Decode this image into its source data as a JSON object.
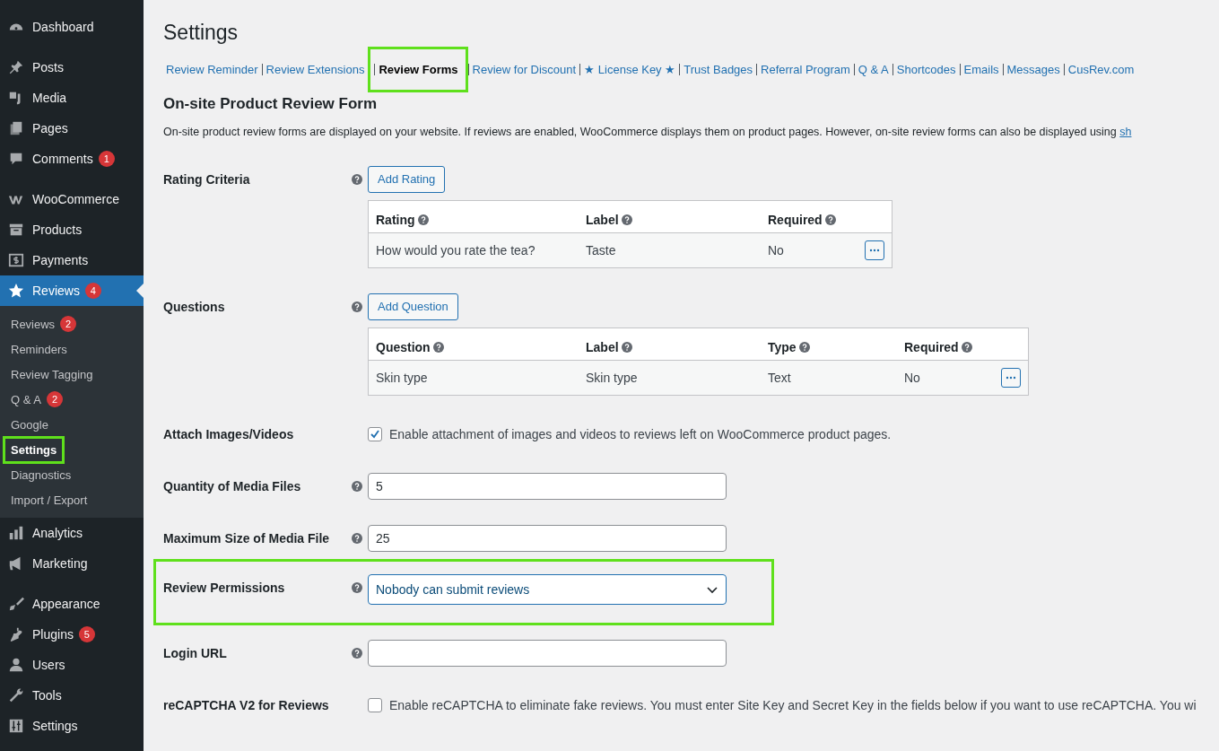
{
  "sidebar": {
    "groups": [
      [
        {
          "label": "Dashboard",
          "selected": false
        }
      ],
      [
        {
          "label": "Posts",
          "selected": false
        },
        {
          "label": "Media",
          "selected": false
        },
        {
          "label": "Pages",
          "selected": false
        },
        {
          "label": "Comments",
          "badge": "1",
          "selected": false
        }
      ],
      [
        {
          "label": "WooCommerce",
          "selected": false
        },
        {
          "label": "Products",
          "selected": false
        },
        {
          "label": "Payments",
          "selected": false
        },
        {
          "label": "Reviews",
          "badge": "4",
          "selected": true,
          "children": [
            {
              "label": "Reviews",
              "badge": "2",
              "selected": false,
              "highlighted": false
            },
            {
              "label": "Reminders",
              "selected": false,
              "highlighted": false
            },
            {
              "label": "Review Tagging",
              "selected": false,
              "highlighted": false
            },
            {
              "label": "Q & A",
              "badge": "2",
              "selected": false,
              "highlighted": false
            },
            {
              "label": "Google",
              "selected": false,
              "highlighted": false
            },
            {
              "label": "Settings",
              "selected": true,
              "highlighted": true
            },
            {
              "label": "Diagnostics",
              "selected": false,
              "highlighted": false
            },
            {
              "label": "Import / Export",
              "selected": false,
              "highlighted": false
            }
          ]
        },
        {
          "label": "Analytics",
          "selected": false
        },
        {
          "label": "Marketing",
          "selected": false
        }
      ],
      [
        {
          "label": "Appearance",
          "selected": false
        },
        {
          "label": "Plugins",
          "badge": "5",
          "selected": false
        },
        {
          "label": "Users",
          "selected": false
        },
        {
          "label": "Tools",
          "selected": false
        },
        {
          "label": "Settings",
          "selected": false
        }
      ]
    ]
  },
  "page_title": "Settings",
  "tabs": [
    {
      "label": "Review Reminder",
      "selected": false,
      "highlighted": false
    },
    {
      "label": "Review Extensions",
      "selected": false,
      "highlighted": false
    },
    {
      "label": "Review Forms",
      "selected": true,
      "highlighted": true
    },
    {
      "label": "Review for Discount",
      "selected": false,
      "highlighted": false
    },
    {
      "label": "★ License Key ★",
      "selected": false,
      "highlighted": false
    },
    {
      "label": "Trust Badges",
      "selected": false,
      "highlighted": false
    },
    {
      "label": "Referral Program",
      "selected": false,
      "highlighted": false
    },
    {
      "label": "Q & A",
      "selected": false,
      "highlighted": false
    },
    {
      "label": "Shortcodes",
      "selected": false,
      "highlighted": false
    },
    {
      "label": "Emails",
      "selected": false,
      "highlighted": false
    },
    {
      "label": "Messages",
      "selected": false,
      "highlighted": false
    },
    {
      "label": "CusRev.com",
      "selected": false,
      "highlighted": false
    }
  ],
  "section": {
    "heading": "On-site Product Review Form",
    "description": "On-site product review forms are displayed on your website. If reviews are enabled, WooCommerce displays them on product pages. However, on-site review forms can also be displayed using ",
    "description_link": "sh"
  },
  "rows": [
    {
      "kind": "table",
      "label": "Rating Criteria",
      "help": true,
      "highlighted": false,
      "button": "Add Rating",
      "columns": [
        "Rating",
        "Label",
        "Required"
      ],
      "rows": [
        [
          "How would you rate the tea?",
          "Taste",
          "No"
        ]
      ]
    },
    {
      "kind": "table",
      "label": "Questions",
      "help": true,
      "highlighted": false,
      "button": "Add Question",
      "columns": [
        "Question",
        "Label",
        "Type",
        "Required"
      ],
      "rows": [
        [
          "Skin type",
          "Skin type",
          "Text",
          "No"
        ]
      ]
    },
    {
      "kind": "checkbox",
      "label": "Attach Images/Videos",
      "help": false,
      "highlighted": false,
      "checked": true,
      "text": "Enable attachment of images and videos to reviews left on WooCommerce product pages."
    },
    {
      "kind": "input",
      "label": "Quantity of Media Files",
      "help": true,
      "highlighted": false,
      "value": "5"
    },
    {
      "kind": "input",
      "label": "Maximum Size of Media File",
      "help": true,
      "highlighted": false,
      "value": "25"
    },
    {
      "kind": "select",
      "label": "Review Permissions",
      "help": true,
      "highlighted": true,
      "value": "Nobody can submit reviews"
    },
    {
      "kind": "input",
      "label": "Login URL",
      "help": true,
      "highlighted": false
    },
    {
      "kind": "checkbox",
      "label": "reCAPTCHA V2 for Reviews",
      "help": false,
      "highlighted": false,
      "checked": false,
      "text": "Enable reCAPTCHA to eliminate fake reviews. You must enter Site Key and Secret Key in the fields below if you want to use reCAPTCHA. You wi"
    }
  ]
}
